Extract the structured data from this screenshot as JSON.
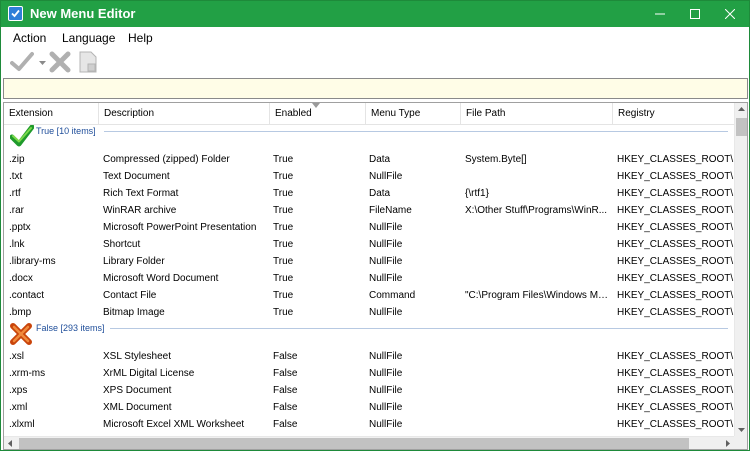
{
  "window": {
    "title": "New Menu Editor",
    "accent_color": "#22a045"
  },
  "menu": [
    {
      "label": "Action"
    },
    {
      "label": "Language"
    },
    {
      "label": "Help"
    }
  ],
  "toolbar": {
    "icons": [
      "apply-checkmark-icon",
      "dropdown-arrow-icon",
      "delete-x-icon",
      "document-icon"
    ]
  },
  "filter": {
    "value": "",
    "background": "#fffde7"
  },
  "columns": [
    {
      "label": "Extension"
    },
    {
      "label": "Description"
    },
    {
      "label": "Enabled"
    },
    {
      "label": "Menu Type"
    },
    {
      "label": "File Path"
    },
    {
      "label": "Registry"
    }
  ],
  "groups": [
    {
      "label": "True [10 items]",
      "icon": "green-checkmark-icon",
      "rows": [
        {
          "ext": ".zip",
          "desc": "Compressed (zipped) Folder",
          "enabled": "True",
          "type": "Data",
          "path": "System.Byte[]",
          "reg": "HKEY_CLASSES_ROOT\\.zip\\"
        },
        {
          "ext": ".txt",
          "desc": "Text Document",
          "enabled": "True",
          "type": "NullFile",
          "path": "",
          "reg": "HKEY_CLASSES_ROOT\\.txt"
        },
        {
          "ext": ".rtf",
          "desc": "Rich Text Format",
          "enabled": "True",
          "type": "Data",
          "path": "{\\rtf1}",
          "reg": "HKEY_CLASSES_ROOT\\.rtf"
        },
        {
          "ext": ".rar",
          "desc": "WinRAR archive",
          "enabled": "True",
          "type": "FileName",
          "path": "X:\\Other Stuff\\Programs\\WinR...",
          "reg": "HKEY_CLASSES_ROOT\\.rar"
        },
        {
          "ext": ".pptx",
          "desc": "Microsoft PowerPoint Presentation",
          "enabled": "True",
          "type": "NullFile",
          "path": "",
          "reg": "HKEY_CLASSES_ROOT\\.pptx"
        },
        {
          "ext": ".lnk",
          "desc": "Shortcut",
          "enabled": "True",
          "type": "NullFile",
          "path": "",
          "reg": "HKEY_CLASSES_ROOT\\.lnk"
        },
        {
          "ext": ".library-ms",
          "desc": "Library Folder",
          "enabled": "True",
          "type": "NullFile",
          "path": "",
          "reg": "HKEY_CLASSES_ROOT\\.librar"
        },
        {
          "ext": ".docx",
          "desc": "Microsoft Word Document",
          "enabled": "True",
          "type": "NullFile",
          "path": "",
          "reg": "HKEY_CLASSES_ROOT\\.docx"
        },
        {
          "ext": ".contact",
          "desc": "Contact File",
          "enabled": "True",
          "type": "Command",
          "path": "\"C:\\Program Files\\Windows Ma...",
          "reg": "HKEY_CLASSES_ROOT\\.conta"
        },
        {
          "ext": ".bmp",
          "desc": "Bitmap Image",
          "enabled": "True",
          "type": "NullFile",
          "path": "",
          "reg": "HKEY_CLASSES_ROOT\\.bmp\\"
        }
      ]
    },
    {
      "label": "False [293 items]",
      "icon": "orange-x-icon",
      "rows": [
        {
          "ext": ".xsl",
          "desc": "XSL Stylesheet",
          "enabled": "False",
          "type": "NullFile",
          "path": "",
          "reg": "HKEY_CLASSES_ROOT\\.xsl"
        },
        {
          "ext": ".xrm-ms",
          "desc": "XrML Digital License",
          "enabled": "False",
          "type": "NullFile",
          "path": "",
          "reg": "HKEY_CLASSES_ROOT\\.xrm-m"
        },
        {
          "ext": ".xps",
          "desc": "XPS Document",
          "enabled": "False",
          "type": "NullFile",
          "path": "",
          "reg": "HKEY_CLASSES_ROOT\\.xps"
        },
        {
          "ext": ".xml",
          "desc": "XML Document",
          "enabled": "False",
          "type": "NullFile",
          "path": "",
          "reg": "HKEY_CLASSES_ROOT\\.xml\\"
        },
        {
          "ext": ".xlxml",
          "desc": "Microsoft Excel XML Worksheet",
          "enabled": "False",
          "type": "NullFile",
          "path": "",
          "reg": "HKEY_CLASSES_ROOT\\.xlxml"
        }
      ]
    }
  ]
}
